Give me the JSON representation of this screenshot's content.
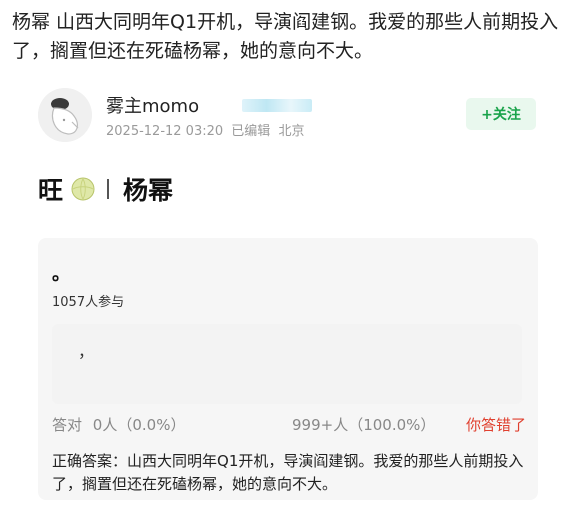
{
  "post": {
    "headline": "杨幂 山西大同明年Q1开机，导演阎建钢。我爱的那些人前期投入了，搁置但还在死磕杨幂，她的意向不大。"
  },
  "author": {
    "name": "雾主momo",
    "date": "2025-12-12 03:20",
    "edited": "已编辑",
    "location": "北京",
    "follow_label": "+关注"
  },
  "topic": {
    "prefix": "旺",
    "name": "杨幂"
  },
  "quiz": {
    "question": "。",
    "participants": "1057人参与",
    "option_text": "，",
    "correct_label": "答对",
    "correct_count": "0人（0.0%）",
    "other_count": "999+人（100.0%）",
    "wrong_label": "你答错了",
    "answer_label": "正确答案：",
    "answer_text": "山西大同明年Q1开机，导演阎建钢。我爱的那些人前期投入了，搁置但还在死磕杨幂，她的意向不大。"
  },
  "colors": {
    "follow_green": "#19a34a",
    "wrong_red": "#e0402f",
    "meta_gray": "#9a9a9a"
  },
  "icons": [
    "avatar-figure",
    "melon-icon"
  ]
}
